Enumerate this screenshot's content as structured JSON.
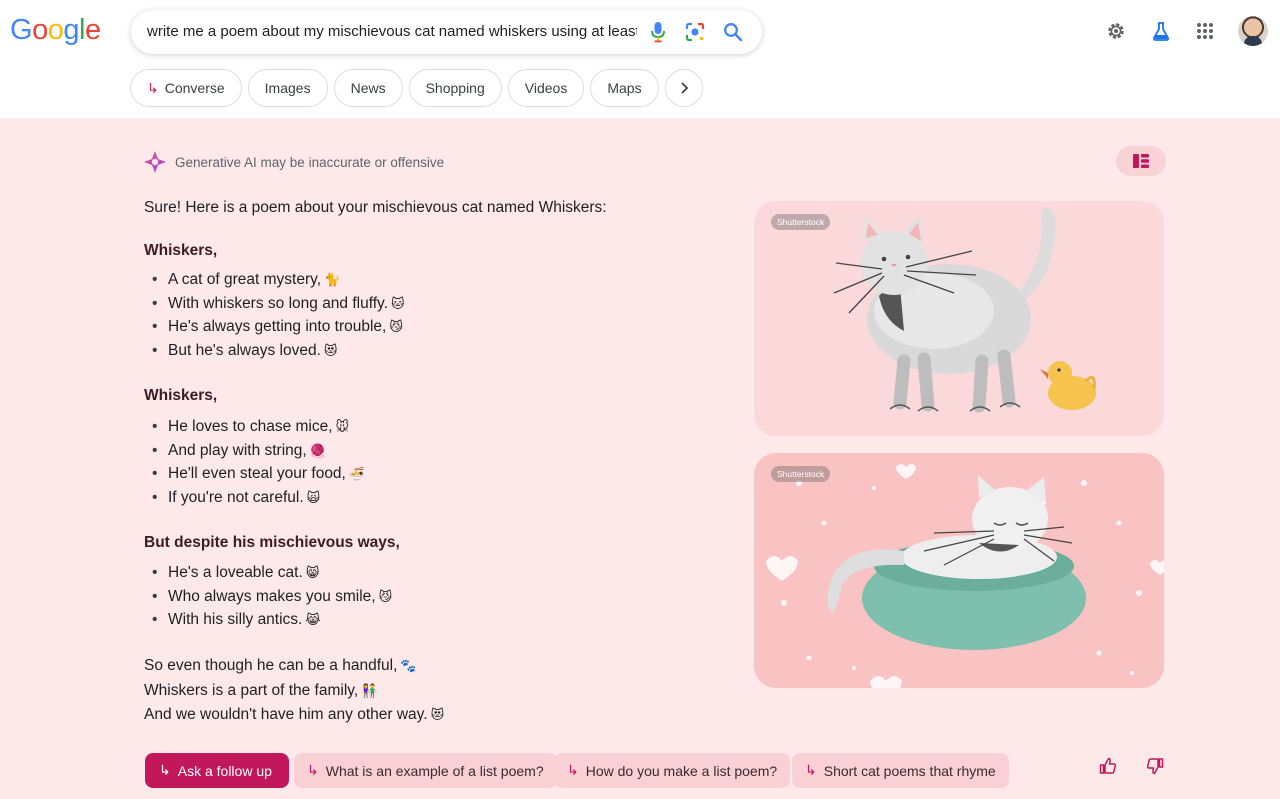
{
  "logo": {
    "letters": [
      "G",
      "o",
      "o",
      "g",
      "l",
      "e"
    ],
    "colors": [
      "#4285f4",
      "#ea4335",
      "#fbbc05",
      "#4285f4",
      "#34a853",
      "#ea4335"
    ]
  },
  "search": {
    "query": "write me a poem about my mischievous cat named whiskers using at least"
  },
  "header_icons": [
    "mic-icon",
    "lens-icon",
    "search-icon",
    "gear-icon",
    "labs-flask-icon",
    "apps-grid-icon",
    "avatar"
  ],
  "tabs": [
    {
      "label": "Converse",
      "icon": "converse-arrow-icon"
    },
    {
      "label": "Images"
    },
    {
      "label": "News"
    },
    {
      "label": "Shopping"
    },
    {
      "label": "Videos"
    },
    {
      "label": "Maps"
    }
  ],
  "ai": {
    "disclaimer": "Generative AI may be inaccurate or offensive",
    "intro": "Sure! Here is a poem about your mischievous cat named Whiskers:",
    "stanzas": [
      {
        "title": "Whiskers,",
        "lines": [
          {
            "text": "A cat of great mystery,",
            "emoji": "🐈"
          },
          {
            "text": "With whiskers so long and fluffy.",
            "emoji": "🐱"
          },
          {
            "text": "He's always getting into trouble,",
            "emoji": "😼"
          },
          {
            "text": "But he's always loved.",
            "emoji": "😻"
          }
        ]
      },
      {
        "title": "Whiskers,",
        "lines": [
          {
            "text": "He loves to chase mice,",
            "emoji": "🐭"
          },
          {
            "text": "And play with string,",
            "emoji": "🧶"
          },
          {
            "text": "He'll even steal your food,",
            "emoji": "🍜"
          },
          {
            "text": "If you're not careful.",
            "emoji": "🙀"
          }
        ]
      },
      {
        "title": "But despite his mischievous ways,",
        "lines": [
          {
            "text": "He's a loveable cat.",
            "emoji": "😸"
          },
          {
            "text": "Who always makes you smile,",
            "emoji": "😼"
          },
          {
            "text": "With his silly antics.",
            "emoji": "😹"
          }
        ]
      }
    ],
    "closing": [
      {
        "text": "So even though he can be a handful,",
        "emoji": "🐾"
      },
      {
        "text": "Whiskers is a part of the family,",
        "emoji": "👫"
      },
      {
        "text": "And we wouldn't have him any other way.",
        "emoji": "😻"
      }
    ],
    "images": [
      {
        "source": "Shutterstock",
        "subject": "cat-with-rubber-duck"
      },
      {
        "source": "Shutterstock",
        "subject": "cat-in-bed"
      }
    ]
  },
  "followups": {
    "primary": "Ask a follow up",
    "suggestions": [
      "What is an example of a list poem?",
      "How do you make a list poem?",
      "Short cat poems that rhyme"
    ]
  },
  "colors": {
    "accent": "#c2185b",
    "ai_background": "#fde9ea",
    "chip_background": "#f9d0d3"
  }
}
